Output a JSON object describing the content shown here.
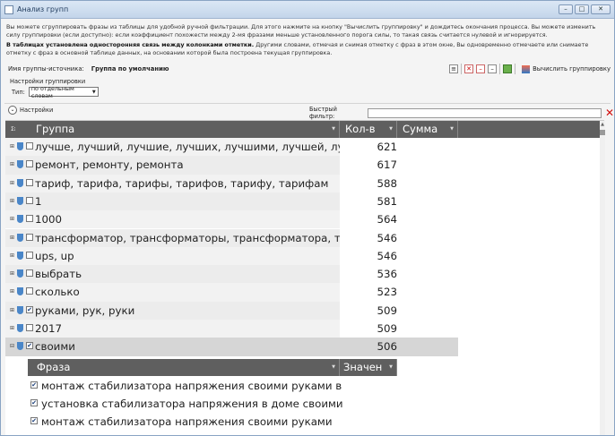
{
  "window": {
    "title": "Анализ групп",
    "controls": {
      "minimize": "–",
      "maximize": "□",
      "close": "✕"
    }
  },
  "info": {
    "p1": "Вы можете сгруппировать фразы из таблицы для удобной ручной фильтрации. Для этого нажмите на кнопку \"Вычислить группировку\" и дождитесь окончания процесса. Вы можете изменить силу группировки (если доступно): если коэффициент похожести между 2-мя фразами меньше установленного порога силы, то такая связь считается нулевой и игнорируется.",
    "p2_bold": "В таблицах установлена односторонняя связь между колонками отметки.",
    "p2_rest": " Другими словами, отмечая и снимая отметку с фраз в этом окне, Вы одновременно отмечаете или снимаете отметку с фраз в основной таблице данных, на основании которой была построена текущая группировка."
  },
  "source": {
    "label": "Имя группы-источника:",
    "value": "Группа по умолчанию",
    "compute_label": "Вычислить группировку"
  },
  "grouping": {
    "title": "Настройки группировки",
    "type_label": "Тип:",
    "type_value": "по отдельным словам"
  },
  "toolbar": {
    "settings_label": "Настройки",
    "filter_label": "Быстрый фильтр:",
    "filter_value": ""
  },
  "columns": {
    "group": "Группа",
    "count": "Кол-в",
    "sum": "Сумма",
    "corner": "Σ⁝"
  },
  "rows": [
    {
      "label": "лучше, лучший, лучшие, лучших, лучшими, лучшей, лучшая",
      "count": "621",
      "checked": false
    },
    {
      "label": "ремонт, ремонту, ремонта",
      "count": "617",
      "checked": false
    },
    {
      "label": "тариф, тарифа, тарифы, тарифов, тарифу, тарифам",
      "count": "588",
      "checked": false
    },
    {
      "label": "1",
      "count": "581",
      "checked": false
    },
    {
      "label": "1000",
      "count": "564",
      "checked": false
    },
    {
      "label": "трансформатор, трансформаторы, трансформатора, трансфо",
      "count": "546",
      "checked": false
    },
    {
      "label": "ups, up",
      "count": "546",
      "checked": false
    },
    {
      "label": "выбрать",
      "count": "536",
      "checked": false
    },
    {
      "label": "сколько",
      "count": "523",
      "checked": false
    },
    {
      "label": "руками, рук, руки",
      "count": "509",
      "checked": true
    },
    {
      "label": "2017",
      "count": "509",
      "checked": false
    },
    {
      "label": "своими",
      "count": "506",
      "checked": true
    }
  ],
  "subtable": {
    "col_phrase": "Фраза",
    "col_value": "Значен",
    "rows": [
      {
        "label": "монтаж стабилизатора напряжения своими руками видео",
        "checked": true
      },
      {
        "label": "установка стабилизатора напряжения в доме своими руками",
        "checked": true
      },
      {
        "label": "монтаж стабилизатора напряжения своими руками",
        "checked": true
      }
    ]
  }
}
